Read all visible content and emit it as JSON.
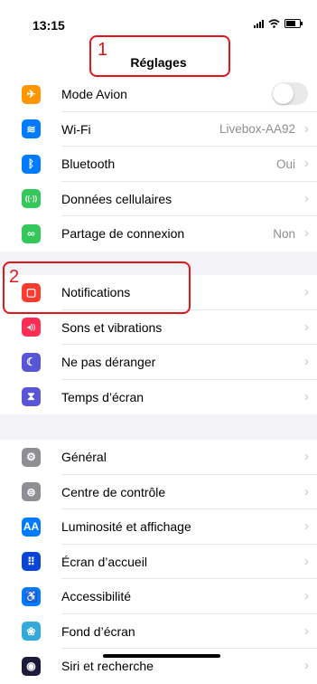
{
  "status_bar": {
    "time": "13:15",
    "battery_level": 0.6
  },
  "header": {
    "title": "Réglages"
  },
  "groups": [
    [
      {
        "label": "Mode Avion",
        "icon": "airplane-icon",
        "color": "#ff9500",
        "glyph": "✈",
        "toggle": false
      },
      {
        "label": "Wi-Fi",
        "icon": "wifi-icon",
        "color": "#007aff",
        "glyph": "≋",
        "value": "Livebox-AA92"
      },
      {
        "label": "Bluetooth",
        "icon": "bluetooth-icon",
        "color": "#007aff",
        "glyph": "ᛒ",
        "value": "Oui"
      },
      {
        "label": "Données cellulaires",
        "icon": "antenna-icon",
        "color": "#34c759",
        "glyph": "((·))"
      },
      {
        "label": "Partage de connexion",
        "icon": "link-icon",
        "color": "#34c759",
        "glyph": "∞",
        "value": "Non"
      }
    ],
    [
      {
        "label": "Notifications",
        "icon": "notifications-icon",
        "color": "#ff3b30",
        "glyph": "▢"
      },
      {
        "label": "Sons et vibrations",
        "icon": "speaker-icon",
        "color": "#ff2d55",
        "glyph": "◂))"
      },
      {
        "label": "Ne pas déranger",
        "icon": "moon-icon",
        "color": "#5856d6",
        "glyph": "☾"
      },
      {
        "label": "Temps d’écran",
        "icon": "hourglass-icon",
        "color": "#5856d6",
        "glyph": "⧗"
      }
    ],
    [
      {
        "label": "Général",
        "icon": "gear-icon",
        "color": "#8e8e93",
        "glyph": "⚙"
      },
      {
        "label": "Centre de contrôle",
        "icon": "toggles-icon",
        "color": "#8e8e93",
        "glyph": "⊜"
      },
      {
        "label": "Luminosité et affichage",
        "icon": "text-size-icon",
        "color": "#007aff",
        "glyph": "AA"
      },
      {
        "label": "Écran d’accueil",
        "icon": "home-grid-icon",
        "color": "#0a45d6",
        "glyph": "⠿"
      },
      {
        "label": "Accessibilité",
        "icon": "accessibility-icon",
        "color": "#007aff",
        "glyph": "♿"
      },
      {
        "label": "Fond d’écran",
        "icon": "wallpaper-icon",
        "color": "#34aadc",
        "glyph": "❀"
      },
      {
        "label": "Siri et recherche",
        "icon": "siri-icon",
        "color": "#1c1c3a",
        "glyph": "◉"
      }
    ]
  ],
  "annotations": [
    {
      "number": "1",
      "target": "Réglages"
    },
    {
      "number": "2",
      "target": "Notifications"
    }
  ],
  "chevron_glyph": "›"
}
